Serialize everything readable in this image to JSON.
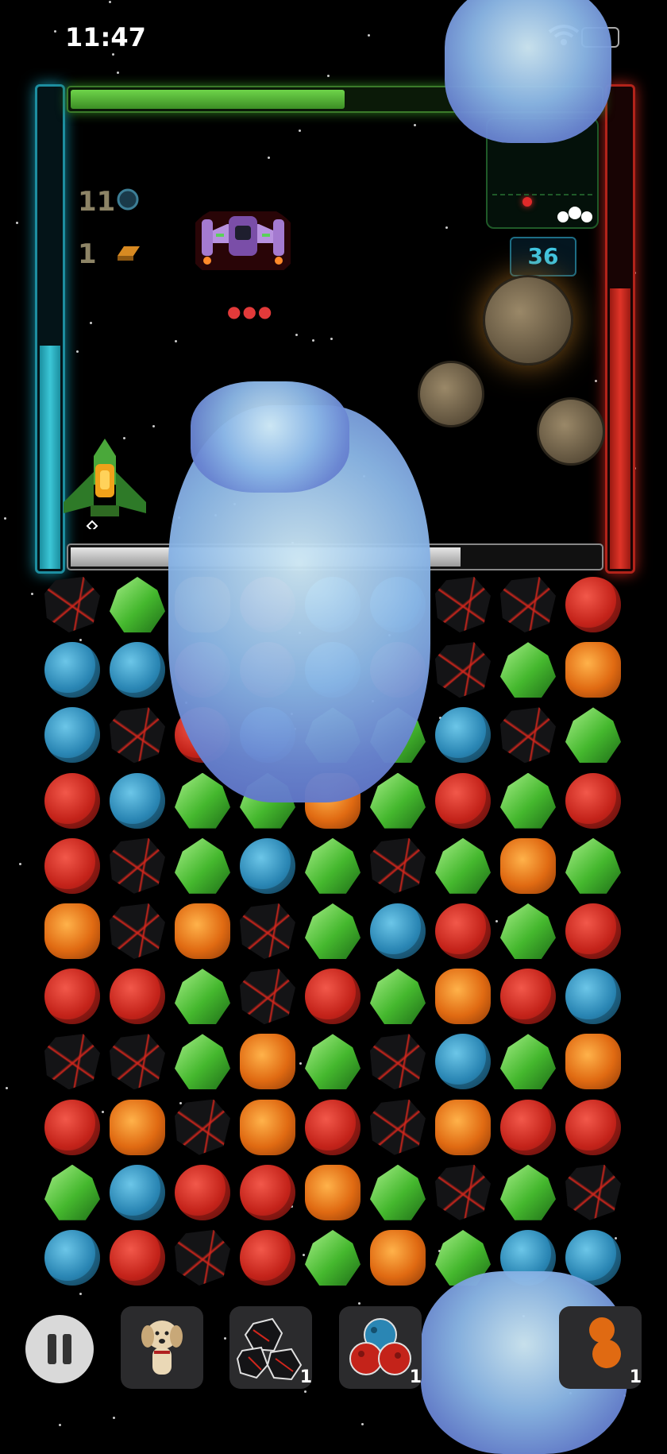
{
  "status_bar": {
    "time": "11:47"
  },
  "hud": {
    "hp_fraction": 0.52,
    "shield_fraction": 0.47,
    "energy_fraction": 0.59,
    "progress_fraction": 0.74,
    "counters": [
      {
        "value": "11",
        "icon": "orb-icon"
      },
      {
        "value": "1",
        "icon": "gold-bar-icon"
      }
    ],
    "timer": "36"
  },
  "board": {
    "rows": [
      [
        "dark",
        "green",
        "orange",
        "red",
        "blue",
        "blue",
        "dark",
        "dark",
        "red"
      ],
      [
        "blue",
        "blue",
        "red",
        "red",
        "blue",
        "red",
        "dark",
        "green",
        "orange"
      ],
      [
        "blue",
        "dark",
        "red",
        "blue",
        "green",
        "green",
        "blue",
        "dark",
        "green"
      ],
      [
        "red",
        "blue",
        "green",
        "green",
        "orange",
        "green",
        "red",
        "green",
        "red"
      ],
      [
        "red",
        "dark",
        "green",
        "blue",
        "green",
        "dark",
        "green",
        "orange",
        "green"
      ],
      [
        "orange",
        "dark",
        "orange",
        "dark",
        "green",
        "blue",
        "red",
        "green",
        "red"
      ],
      [
        "red",
        "red",
        "green",
        "dark",
        "red",
        "green",
        "orange",
        "red",
        "blue"
      ],
      [
        "dark",
        "dark",
        "green",
        "orange",
        "green",
        "dark",
        "blue",
        "green",
        "orange"
      ],
      [
        "red",
        "orange",
        "dark",
        "orange",
        "red",
        "dark",
        "orange",
        "red",
        "red"
      ],
      [
        "green",
        "blue",
        "red",
        "red",
        "orange",
        "green",
        "dark",
        "green",
        "dark"
      ],
      [
        "blue",
        "red",
        "dark",
        "red",
        "green",
        "orange",
        "green",
        "blue",
        "blue"
      ]
    ]
  },
  "toolbar": {
    "slots": [
      {
        "name": "pet-slot",
        "count": ""
      },
      {
        "name": "dark-bomb-slot",
        "count": "1"
      },
      {
        "name": "mixed-bomb-slot",
        "count": "1"
      },
      {
        "name": "fire-bomb-slot",
        "count": "1"
      }
    ]
  }
}
